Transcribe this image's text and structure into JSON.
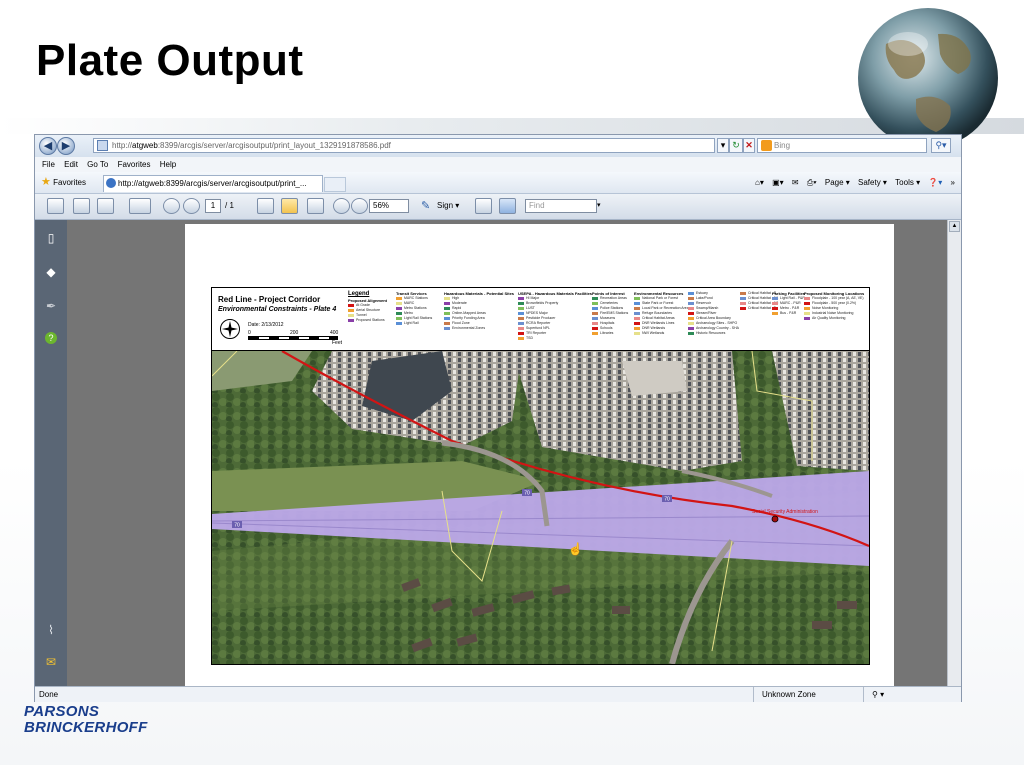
{
  "slide": {
    "title": "Plate Output",
    "logo_line1": "PARSONS",
    "logo_line2": "BRINCKERHOFF"
  },
  "browser": {
    "url_prefix": "http://",
    "url_host": "atgweb",
    "url_rest": ":8399/arcgis/server/arcgisoutput/print_layout_1329191878586.pdf",
    "search_placeholder": "Bing",
    "menu": [
      "File",
      "Edit",
      "Go To",
      "Favorites",
      "Help"
    ],
    "favorites_label": "Favorites",
    "tab_title": "http://atgweb:8399/arcgis/server/arcgisoutput/print_...",
    "commands": [
      "Page ▾",
      "Safety ▾",
      "Tools ▾"
    ],
    "status_left": "Done",
    "status_zone": "Unknown Zone",
    "status_zoom": "▾"
  },
  "pdf_toolbar": {
    "page_current": "1",
    "page_total": "/ 1",
    "zoom": "56%",
    "sign_label": "Sign ▾",
    "find_placeholder": "Find"
  },
  "plate": {
    "title": "Red Line - Project Corridor",
    "subtitle": "Environmental Constraints - Plate 4",
    "legend_title": "Legend",
    "scale_labels": [
      "0",
      "200",
      "400"
    ],
    "scale_unit": "Feet",
    "date_line": "Date: 2/13/2012",
    "legend_columns": [
      {
        "heading": "Proposed Alignment",
        "items": [
          "At Grade",
          "Aerial Structure",
          "Tunnel",
          "Proposed Stations"
        ]
      },
      {
        "heading": "Transit Services",
        "items": [
          "MARC Stations",
          "MARC",
          "Metro Stations",
          "Metro",
          "Light Rail Stations",
          "Light Rail"
        ]
      },
      {
        "heading": "Hazardous Materials - Potential Sites",
        "items": [
          "High",
          "Moderate",
          "Rapid",
          "Online-Mapped Areas",
          "Priority Funding Area",
          "Flood Zone",
          "Environmental Zones"
        ]
      },
      {
        "heading": "USEPA - Hazardous Materials Facilities",
        "items": [
          "HI Major",
          "Brownfields Property",
          "LUST",
          "NPDES Major",
          "Pesticide Producer",
          "RCRA Reporter",
          "Superfund NPL",
          "TRI Reporter",
          "TSD"
        ]
      },
      {
        "heading": "Points of Interest",
        "items": [
          "Recreation Areas",
          "Cemeteries",
          "Police Stations",
          "Fire/EMS Stations",
          "Museums",
          "Hospitals",
          "Schools",
          "Libraries"
        ]
      },
      {
        "heading": "Environmental Resources",
        "items": [
          "National Park or Forest",
          "State Park or Forest",
          "Local Park or Recreation Area",
          "Refuge Boundaries",
          "Critical Habitat Areas",
          "DNR Wetlands Lines",
          "DNR Wetlands",
          "NWI Wetlands"
        ]
      },
      {
        "heading": "",
        "items": [
          "Estuary",
          "Lake/Pond",
          "Reservoir",
          "Swamp/Marsh",
          "Stream/River",
          "Critical Area Boundary",
          "Archaeology Sites - SHPO",
          "Archaeology Country - SHA",
          "Historic Resources"
        ]
      },
      {
        "heading": "",
        "items": [
          "Critical Habitat - B",
          "Critical Habitat - N1",
          "Critical Habitat - N2",
          "Critical Habitat - T"
        ]
      },
      {
        "heading": "Parking Facilities",
        "items": [
          "Light Rail - P&R",
          "MARC - P&R",
          "Metro - P&R",
          "Bus - P&R"
        ]
      },
      {
        "heading": "Proposed Monitoring Locations",
        "items": [
          "Floodplain - 100 year (A, AE, VE)",
          "Floodplain - 500 year (0.2%)",
          "Noise Monitoring",
          "Industrial Noise Monitoring",
          "Air Quality Monitoring"
        ]
      }
    ],
    "map_label_station": "Social Security Administration",
    "road_shields": [
      "70",
      "70",
      "70"
    ]
  },
  "colors": {
    "title": "#000000",
    "logo": "#1a3e8c",
    "alignment": "#d21414",
    "highway": "#b7a3e6"
  }
}
